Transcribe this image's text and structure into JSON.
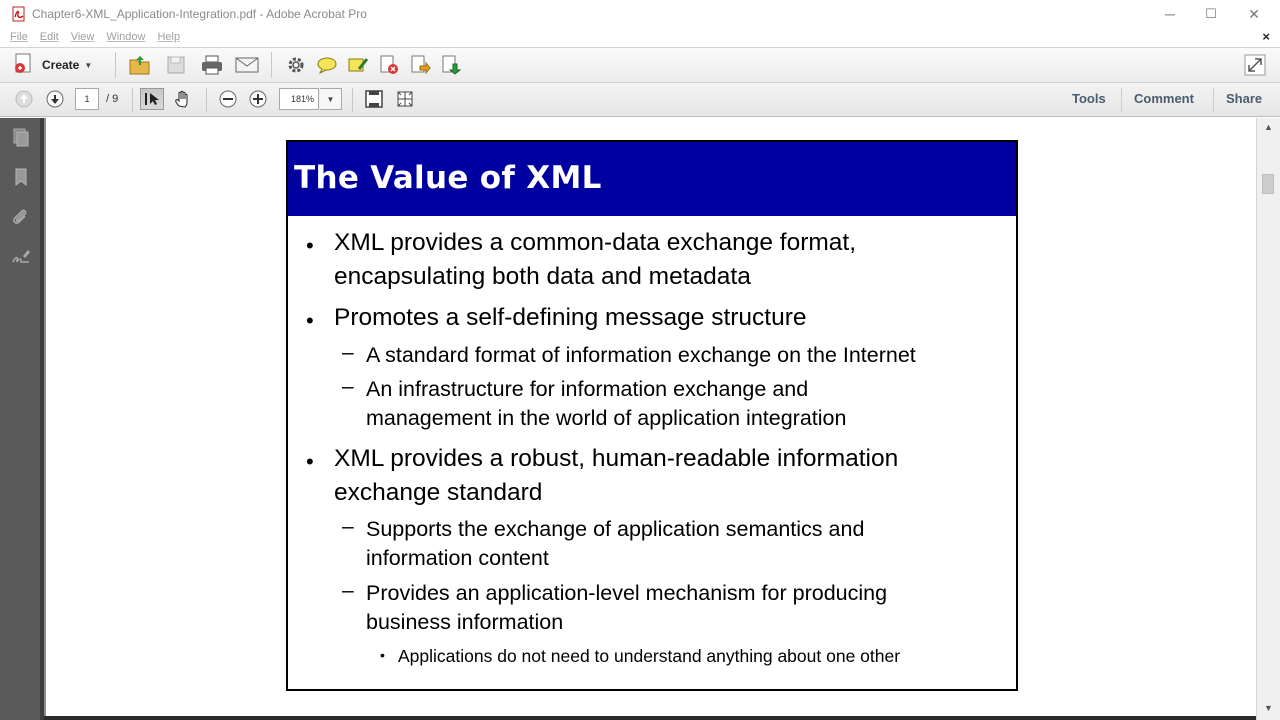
{
  "window": {
    "title": "Chapter6-XML_Application-Integration.pdf - Adobe Acrobat Pro",
    "minimize": "─",
    "maximize": "☐",
    "close": "✕"
  },
  "menu": {
    "items": [
      "File",
      "Edit",
      "View",
      "Window",
      "Help"
    ],
    "close_doc": "×"
  },
  "toolbar": {
    "create_label": "Create",
    "caret": "▼"
  },
  "nav": {
    "page_current": "1",
    "page_total": "/ 9",
    "zoom": "181%",
    "zoom_caret": "▼"
  },
  "panels": {
    "tools": "Tools",
    "comment": "Comment",
    "share": "Share"
  },
  "scrollbar": {
    "up": "▲",
    "down": "▼"
  },
  "slide": {
    "title": "The Value of XML",
    "bullets": [
      {
        "marker": "•",
        "lines": [
          "XML provides a common-data exchange format,",
          "encapsulating both data and metadata"
        ]
      },
      {
        "marker": "•",
        "lines": [
          "Promotes a self-defining message structure"
        ]
      },
      {
        "marker": "–",
        "lines": [
          "A standard format of information exchange on the Internet"
        ]
      },
      {
        "marker": "–",
        "lines": [
          "An infrastructure for information exchange and",
          "management in the world of application integration"
        ]
      },
      {
        "marker": "•",
        "lines": [
          "XML provides a robust, human-readable information",
          "exchange standard"
        ]
      },
      {
        "marker": "–",
        "lines": [
          "Supports the exchange of application semantics and",
          "information content"
        ]
      },
      {
        "marker": "–",
        "lines": [
          "Provides an application-level mechanism for producing",
          "business information"
        ]
      },
      {
        "marker": "•",
        "lines": [
          "Applications do not need to understand anything about one other"
        ]
      }
    ]
  }
}
